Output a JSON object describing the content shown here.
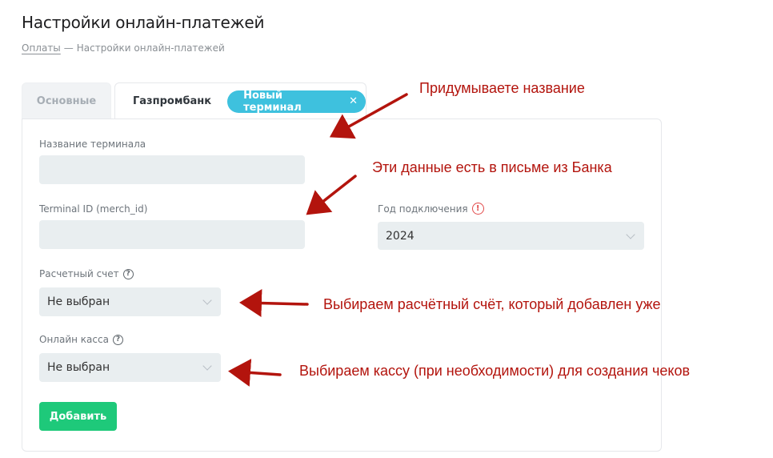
{
  "page": {
    "title": "Настройки онлайн-платежей",
    "breadcrumb": {
      "link": "Оплаты",
      "separator": "—",
      "current": "Настройки онлайн-платежей"
    }
  },
  "tabs": {
    "main": "Основные",
    "active": "Газпромбанк",
    "new_terminal": "Новый терминал",
    "close_glyph": "✕"
  },
  "form": {
    "terminal_name": {
      "label": "Название терминала",
      "value": ""
    },
    "terminal_id": {
      "label": "Terminal ID (merch_id)",
      "value": ""
    },
    "year": {
      "label": "Год подключения",
      "value": "2024",
      "warn_glyph": "!"
    },
    "account": {
      "label": "Расчетный счет",
      "value": "Не выбран",
      "help_glyph": "?"
    },
    "cashbox": {
      "label": "Онлайн касса",
      "value": "Не выбран",
      "help_glyph": "?"
    },
    "submit_label": "Добавить"
  },
  "annotations": {
    "name_hint": "Придумываете название",
    "bank_data_hint": "Эти данные есть в письме из Банка",
    "account_hint": "Выбираем расчётный счёт, который добавлен уже",
    "cashbox_hint": "Выбираем кассу (при необходимости) для создания чеков"
  },
  "colors": {
    "accent_pill": "#3ec1de",
    "submit_button": "#1ec97a",
    "annotation": "#b3140d",
    "warning": "#e24b4b"
  }
}
